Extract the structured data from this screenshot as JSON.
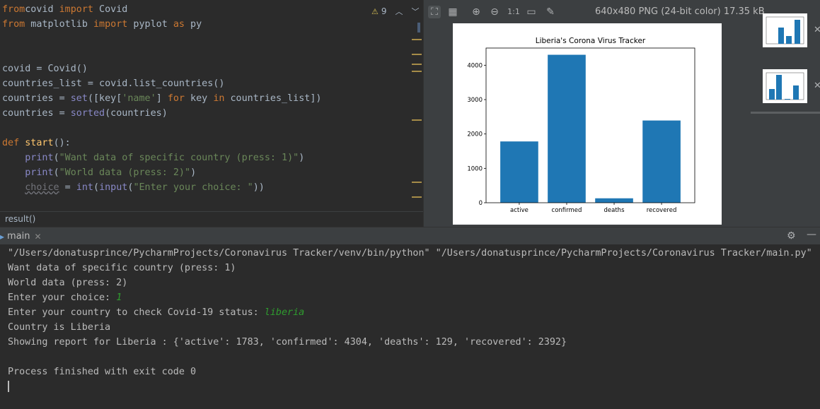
{
  "editor": {
    "lines": [
      {
        "parts": [
          [
            "kw",
            "from"
          ],
          [
            "",
            "covid "
          ],
          [
            "kw",
            "import"
          ],
          [
            "",
            " Covid"
          ]
        ]
      },
      {
        "parts": [
          [
            "kw",
            "from"
          ],
          [
            "",
            " matplotlib "
          ],
          [
            "kw",
            "import"
          ],
          [
            "",
            " pyplot "
          ],
          [
            "kw",
            "as"
          ],
          [
            "",
            " py"
          ]
        ]
      },
      {
        "parts": []
      },
      {
        "parts": []
      },
      {
        "parts": [
          [
            "",
            "covid = Covid()"
          ]
        ]
      },
      {
        "parts": [
          [
            "",
            "countries_list = covid.list_countries()"
          ]
        ]
      },
      {
        "parts": [
          [
            "",
            "countries = "
          ],
          [
            "bi",
            "set"
          ],
          [
            "",
            "([key["
          ],
          [
            "str",
            "'name'"
          ],
          [
            "",
            "] "
          ],
          [
            "kw",
            "for"
          ],
          [
            "",
            " key "
          ],
          [
            "kw",
            "in"
          ],
          [
            "",
            " countries_list])"
          ]
        ]
      },
      {
        "parts": [
          [
            "",
            "countries = "
          ],
          [
            "bi",
            "sorted"
          ],
          [
            "",
            "(countries)"
          ]
        ]
      },
      {
        "parts": []
      },
      {
        "parts": [
          [
            "kw",
            "def "
          ],
          [
            "fn",
            "start"
          ],
          [
            "",
            "():"
          ]
        ]
      },
      {
        "parts": [
          [
            "",
            "    "
          ],
          [
            "bi",
            "print"
          ],
          [
            "",
            "("
          ],
          [
            "str",
            "\"Want data of specific country (press: 1)\""
          ],
          [
            "",
            ")"
          ]
        ]
      },
      {
        "parts": [
          [
            "",
            "    "
          ],
          [
            "bi",
            "print"
          ],
          [
            "",
            "("
          ],
          [
            "str",
            "\"World data (press: 2)\""
          ],
          [
            "",
            ")"
          ]
        ]
      },
      {
        "parts": [
          [
            "",
            "    "
          ],
          [
            "var-grey",
            "choice"
          ],
          [
            "",
            " = "
          ],
          [
            "bi",
            "int"
          ],
          [
            "",
            "("
          ],
          [
            "bi",
            "input"
          ],
          [
            "",
            "("
          ],
          [
            "str",
            "\"Enter your choice: \""
          ],
          [
            "",
            "))"
          ]
        ]
      }
    ],
    "inspection_count": "9",
    "breadcrumb": "result()"
  },
  "viewer": {
    "image_info": "640x480 PNG (24-bit color) 17.35 kB",
    "zoom_label": "1:1",
    "icons": [
      "fit-zoom-icon",
      "grid-icon",
      "zoom-in-icon",
      "zoom-out-icon",
      "actual-size-icon",
      "background-icon",
      "color-picker-icon"
    ]
  },
  "chart_data": {
    "type": "bar",
    "title": "Liberia's Corona Virus Tracker",
    "categories": [
      "active",
      "confirmed",
      "deaths",
      "recovered"
    ],
    "values": [
      1783,
      4304,
      129,
      2392
    ],
    "ylim": [
      0,
      4500
    ],
    "yticks": [
      0,
      1000,
      2000,
      3000,
      4000
    ],
    "color": "#1f77b4",
    "grid": false
  },
  "run": {
    "tab_label": "main",
    "lines": [
      {
        "parts": [
          [
            "",
            "\"/Users/donatusprince/PycharmProjects/Coronavirus Tracker/venv/bin/python\" \"/Users/donatusprince/PycharmProjects/Coronavirus Tracker/main.py\""
          ]
        ]
      },
      {
        "parts": [
          [
            "",
            "Want data of specific country (press: 1)"
          ]
        ]
      },
      {
        "parts": [
          [
            "",
            "World data (press: 2)"
          ]
        ]
      },
      {
        "parts": [
          [
            "",
            "Enter your choice: "
          ],
          [
            "input-echo",
            "1"
          ]
        ]
      },
      {
        "parts": [
          [
            "",
            "Enter your country to check Covid-19 status: "
          ],
          [
            "input-echo",
            "liberia"
          ]
        ]
      },
      {
        "parts": [
          [
            "",
            "Country is Liberia"
          ]
        ]
      },
      {
        "parts": [
          [
            "",
            "Showing report for Liberia : {'active': 1783, 'confirmed': 4304, 'deaths': 129, 'recovered': 2392}"
          ]
        ]
      },
      {
        "parts": []
      },
      {
        "parts": [
          [
            "",
            "Process finished with exit code 0"
          ]
        ]
      }
    ]
  }
}
